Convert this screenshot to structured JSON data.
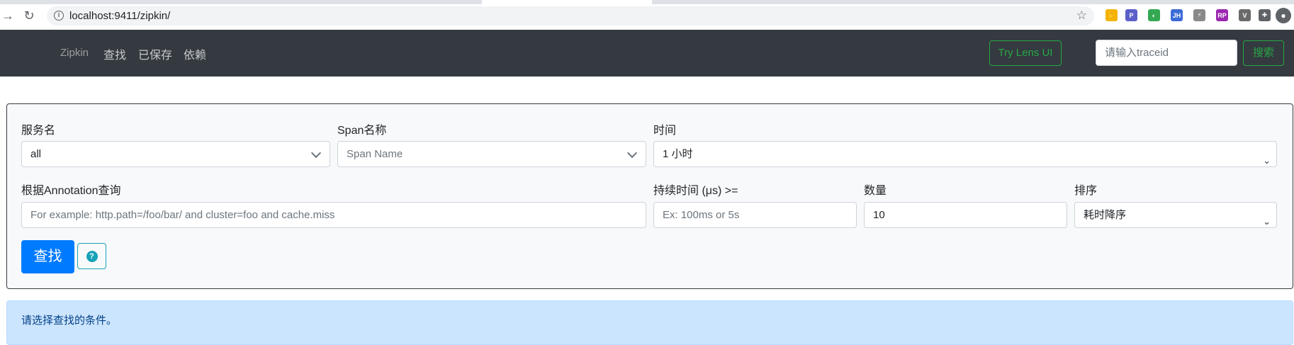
{
  "browser": {
    "url": "localhost:9411/zipkin/",
    "extensions": [
      {
        "name": "hand-extension-icon",
        "color": "#f4b400",
        "glyph": "✋"
      },
      {
        "name": "search-extension-icon",
        "color": "#5b5fc7",
        "glyph": "P"
      },
      {
        "name": "chrome-color-extension-icon",
        "color": "#34a853",
        "glyph": "◐"
      },
      {
        "name": "jh-extension-icon",
        "color": "#3b6bd6",
        "glyph": "JH"
      },
      {
        "name": "tool-extension-icon",
        "color": "#8a8a8a",
        "glyph": "⚡"
      },
      {
        "name": "rp-extension-icon",
        "color": "#9c27b0",
        "glyph": "RP"
      },
      {
        "name": "vue-extension-icon",
        "color": "#6a6a6a",
        "glyph": "V"
      },
      {
        "name": "puzzle-extension-icon",
        "color": "#5f6368",
        "glyph": "✚"
      }
    ]
  },
  "navbar": {
    "brand": "Zipkin",
    "links": [
      "查找",
      "已保存",
      "依赖"
    ],
    "lens_button": "Try Lens UI",
    "traceid_placeholder": "请输入traceid",
    "search_button": "搜索"
  },
  "query": {
    "service_label": "服务名",
    "service_value": "all",
    "span_label": "Span名称",
    "span_placeholder": "Span Name",
    "time_label": "时间",
    "time_value": "1 小时",
    "annotation_label": "根据Annotation查询",
    "annotation_placeholder": "For example: http.path=/foo/bar/ and cluster=foo and cache.miss",
    "duration_label": "持续时间 (μs) >=",
    "duration_placeholder": "Ex: 100ms or 5s",
    "limit_label": "数量",
    "limit_value": "10",
    "sort_label": "排序",
    "sort_value": "耗时降序",
    "find_button": "查找",
    "help_glyph": "?"
  },
  "alert": {
    "text": "请选择查找的条件。"
  },
  "colors": {
    "navbar": "#343a40",
    "success": "#28a745",
    "primary": "#007bff",
    "info": "#17a2b8",
    "alert_bg": "#cce5ff"
  }
}
